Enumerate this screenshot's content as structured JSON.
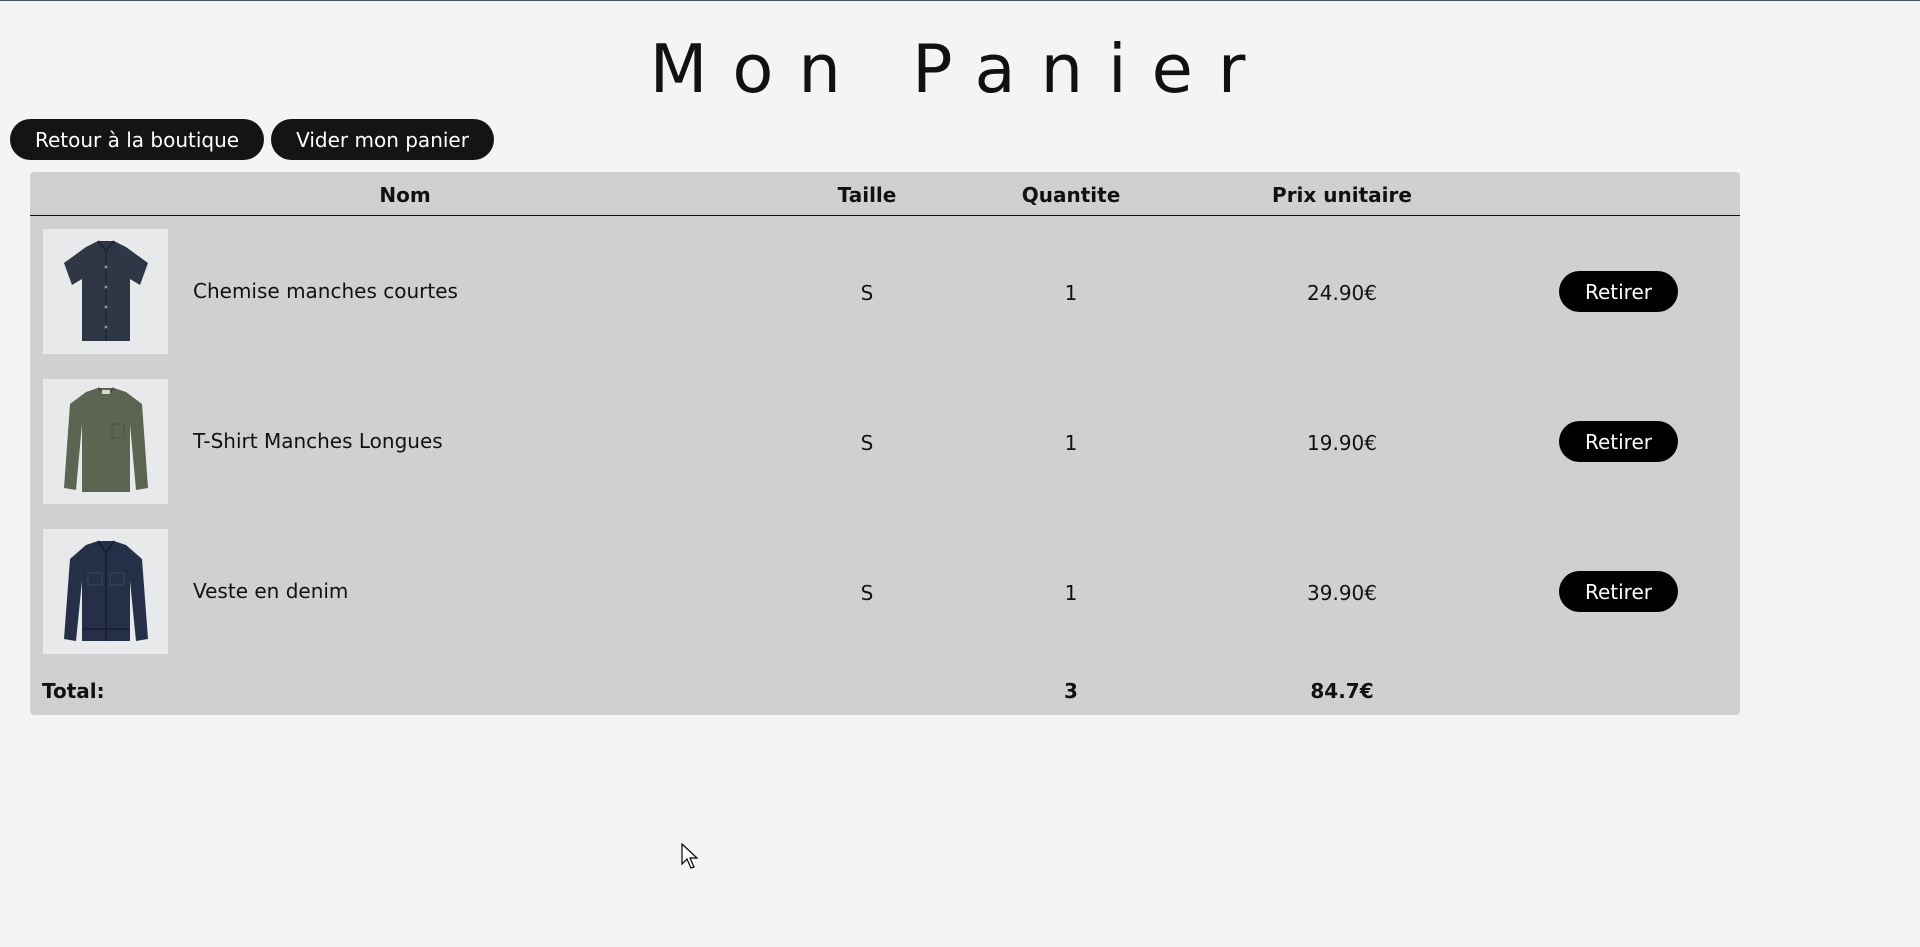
{
  "page": {
    "title": "Mon Panier"
  },
  "actions": {
    "back_label": "Retour à la boutique",
    "clear_label": "Vider mon panier"
  },
  "table": {
    "headers": {
      "name": "Nom",
      "size": "Taille",
      "quantity": "Quantite",
      "unit_price": "Prix unitaire"
    },
    "items": [
      {
        "name": "Chemise manches courtes",
        "size": "S",
        "quantity": "1",
        "price": "24.90€",
        "remove_label": "Retirer",
        "image": "short-sleeve-shirt-image",
        "color": "#2f3747"
      },
      {
        "name": "T-Shirt Manches Longues",
        "size": "S",
        "quantity": "1",
        "price": "19.90€",
        "remove_label": "Retirer",
        "image": "long-sleeve-tshirt-image",
        "color": "#5c6551"
      },
      {
        "name": "Veste en denim",
        "size": "S",
        "quantity": "1",
        "price": "39.90€",
        "remove_label": "Retirer",
        "image": "denim-jacket-image",
        "color": "#253048"
      }
    ],
    "total": {
      "label": "Total:",
      "quantity": "3",
      "price": "84.7€"
    }
  },
  "colors": {
    "background": "#f4f4f4",
    "table_background": "#d0d0d0",
    "button": "#000000"
  }
}
